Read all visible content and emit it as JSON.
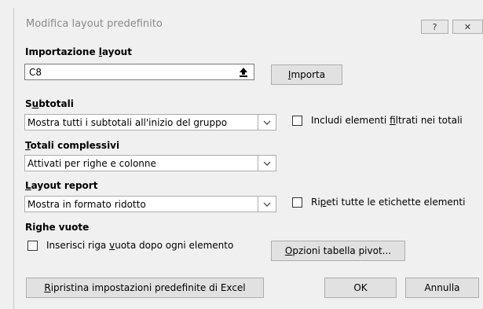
{
  "window": {
    "title": "Modifica layout predefinito",
    "help_label": "?",
    "close_label": "✕"
  },
  "import": {
    "section_label": "Importazione layout",
    "cell_value": "C8",
    "import_button": "Importa"
  },
  "subtotals": {
    "section_label": "Subtotali",
    "selected": "Mostra tutti i subtotali all'inizio del gruppo",
    "checkbox_label": "Includi elementi filtrati nei totali",
    "checked": false
  },
  "grand_totals": {
    "section_label": "Totali complessivi",
    "selected": "Attivati per righe e colonne"
  },
  "report_layout": {
    "section_label": "Layout report",
    "selected": "Mostra in formato ridotto",
    "checkbox_label": "Ripeti tutte le etichette elementi",
    "checked": false
  },
  "blank_rows": {
    "section_label": "Righe vuote",
    "checkbox_label": "Inserisci riga vuota dopo ogni elemento",
    "checked": false,
    "pivot_options_button": "Opzioni tabella pivot..."
  },
  "footer": {
    "reset_button": "Ripristina impostazioni predefinite di Excel",
    "ok_button": "OK",
    "cancel_button": "Annulla"
  },
  "icons": {
    "collapse": "collapse-dialog-icon",
    "dropdown": "chevron-down-icon",
    "help": "help-icon",
    "close": "close-icon"
  }
}
